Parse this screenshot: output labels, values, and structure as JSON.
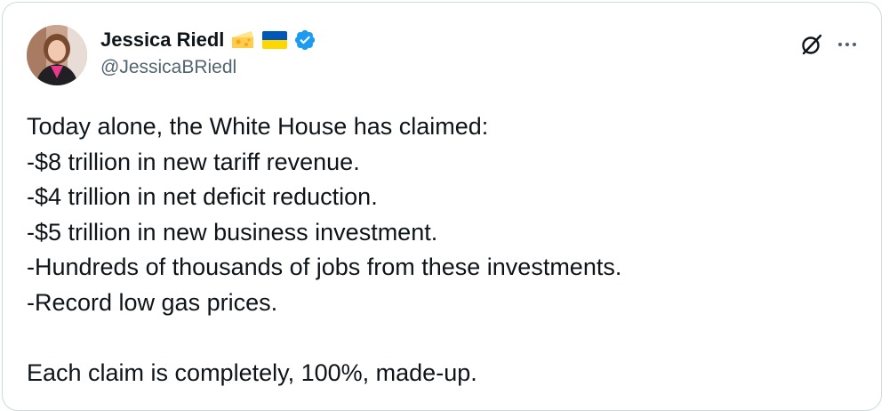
{
  "author": {
    "display_name": "Jessica Riedl",
    "emojis": [
      "cheese-emoji",
      "ukraine-flag-emoji"
    ],
    "verified": true,
    "handle": "@JessicaBRiedl"
  },
  "actions": {
    "grok_icon": "grok-slash-circle-icon",
    "more_icon": "more-horizontal-icon"
  },
  "tweet": {
    "lines": [
      "Today alone, the White House has claimed:",
      "-$8 trillion in new tariff revenue.",
      "-$4 trillion in net deficit reduction.",
      "-$5 trillion in new business investment.",
      "-Hundreds of thousands of jobs from these investments.",
      "-Record low gas prices."
    ],
    "closing": "Each claim is completely, 100%, made-up."
  },
  "colors": {
    "text": "#0f1419",
    "secondary": "#536471",
    "verified_blue": "#1d9bf0",
    "border": "#cfd9de",
    "flag_blue": "#0057b7",
    "flag_yellow": "#ffd700"
  }
}
